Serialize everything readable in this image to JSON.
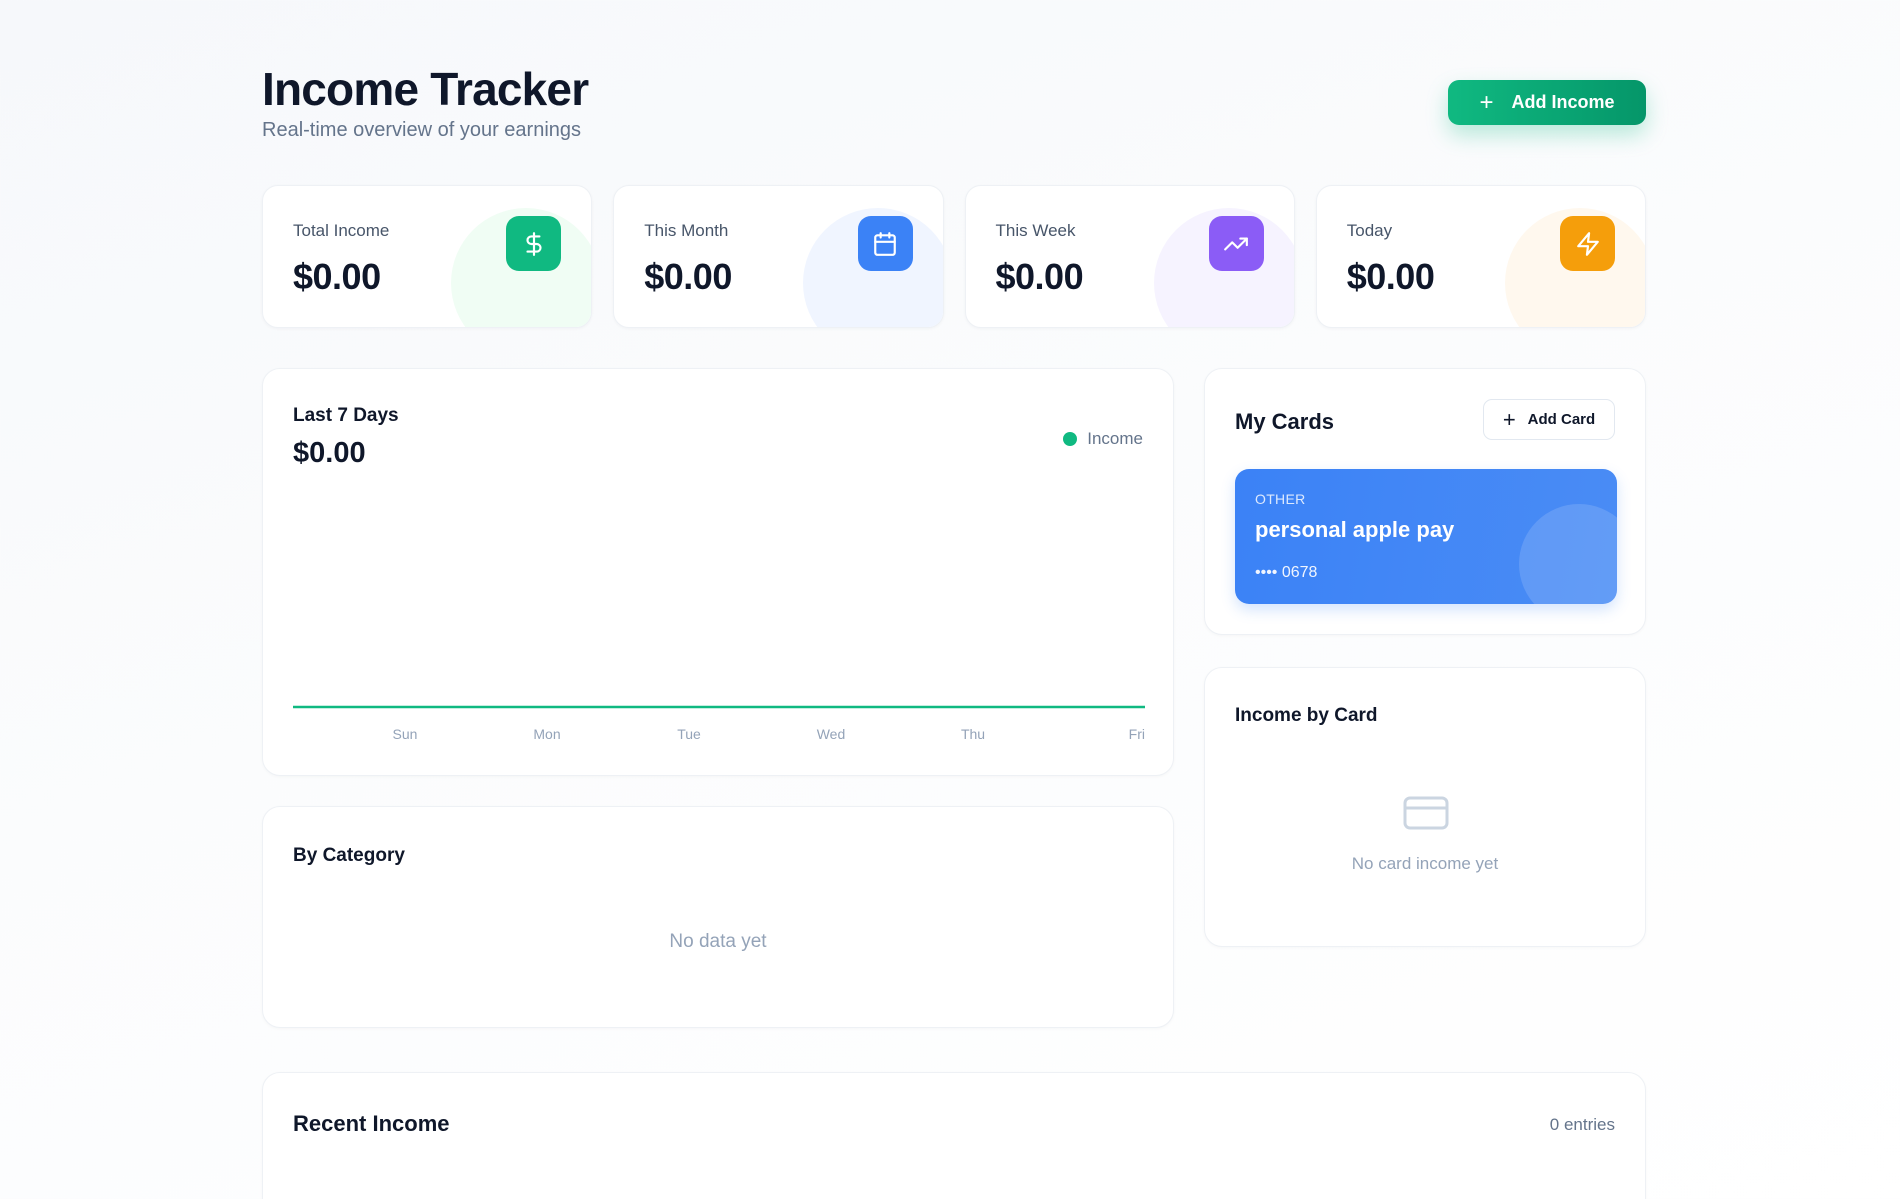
{
  "header": {
    "title": "Income Tracker",
    "subtitle": "Real-time overview of your earnings",
    "add_income_label": "Add Income"
  },
  "stats": [
    {
      "label": "Total Income",
      "value": "$0.00",
      "icon": "dollar-icon",
      "color": "#10b981",
      "blob": "#f0fdf4"
    },
    {
      "label": "This Month",
      "value": "$0.00",
      "icon": "calendar-icon",
      "color": "#3b82f6",
      "blob": "#f0f5ff"
    },
    {
      "label": "This Week",
      "value": "$0.00",
      "icon": "trending-up-icon",
      "color": "#8b5cf6",
      "blob": "#f6f3ff"
    },
    {
      "label": "Today",
      "value": "$0.00",
      "icon": "lightning-icon",
      "color": "#f59e0b",
      "blob": "#fff8ee"
    }
  ],
  "chart_panel": {
    "title": "Last 7 Days",
    "total": "$0.00",
    "legend_label": "Income"
  },
  "chart_data": {
    "type": "line",
    "categories": [
      "Sun",
      "Mon",
      "Tue",
      "Wed",
      "Thu",
      "Fri"
    ],
    "series": [
      {
        "name": "Income",
        "values": [
          0,
          0,
          0,
          0,
          0,
          0
        ]
      }
    ],
    "xlabel": "",
    "ylabel": "",
    "ylim": [
      0,
      1
    ],
    "grid": false,
    "legend": "top-right",
    "color": "#10b981"
  },
  "category_panel": {
    "title": "By Category",
    "empty": "No data yet"
  },
  "cards_panel": {
    "title": "My Cards",
    "add_card_label": "Add Card",
    "card": {
      "type": "OTHER",
      "name": "personal apple pay",
      "number": "•••• 0678"
    }
  },
  "bycard_panel": {
    "title": "Income by Card",
    "empty": "No card income yet"
  },
  "recent_panel": {
    "title": "Recent Income",
    "count": "0 entries"
  }
}
